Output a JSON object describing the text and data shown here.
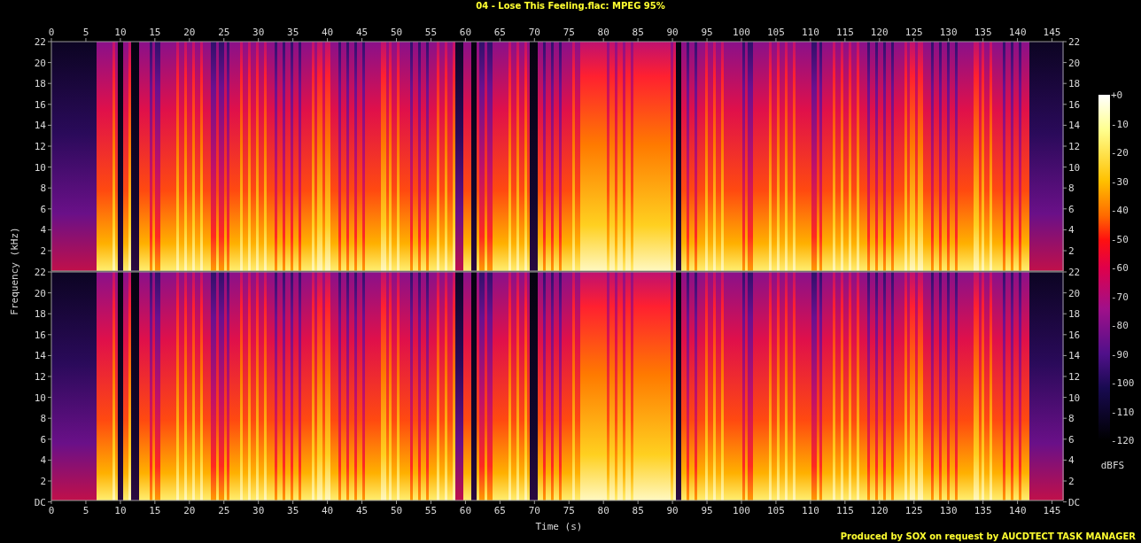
{
  "title": "04 - Lose This Feeling.flac: MPEG 95%",
  "x_axis": {
    "label": "Time (s)",
    "top_ticks": [
      "0",
      "5",
      "10",
      "15",
      "20",
      "25",
      "30",
      "35",
      "40",
      "45",
      "50",
      "55",
      "60",
      "65",
      "70",
      "75",
      "80",
      "85",
      "90",
      "95",
      "100",
      "105",
      "110",
      "115",
      "120",
      "125",
      "130",
      "135",
      "140",
      "145"
    ],
    "bottom_ticks": [
      "0",
      "5",
      "10",
      "15",
      "20",
      "25",
      "30",
      "35",
      "40",
      "45",
      "50",
      "55",
      "60",
      "65",
      "70",
      "75",
      "80",
      "85",
      "90",
      "95",
      "100",
      "105",
      "110",
      "115",
      "120",
      "125",
      "130",
      "135",
      "140",
      "145"
    ]
  },
  "y_axis": {
    "label": "Frequency (kHz)",
    "top_left_ticks": [
      "22",
      "20",
      "18",
      "16",
      "14",
      "12",
      "10",
      "8",
      "6",
      "4",
      "2"
    ],
    "bottom_left_ticks": [
      "22",
      "20",
      "18",
      "16",
      "14",
      "12",
      "10",
      "8",
      "6",
      "4",
      "2",
      "DC"
    ],
    "top_right_ticks": [
      "22",
      "20",
      "18",
      "16",
      "14",
      "12",
      "10",
      "8",
      "6",
      "4",
      "2"
    ],
    "bottom_right_ticks": [
      "22",
      "20",
      "18",
      "16",
      "14",
      "12",
      "10",
      "8",
      "6",
      "4",
      "2",
      "DC"
    ]
  },
  "colorbar": {
    "ticks": [
      "+0",
      "-10",
      "-20",
      "-30",
      "-40",
      "-50",
      "-60",
      "-70",
      "-80",
      "-90",
      "-100",
      "-110",
      "-120"
    ],
    "unit": "dBFS"
  },
  "footer": "Produced by SOX on request by AUCDTECT TASK MANAGER"
}
